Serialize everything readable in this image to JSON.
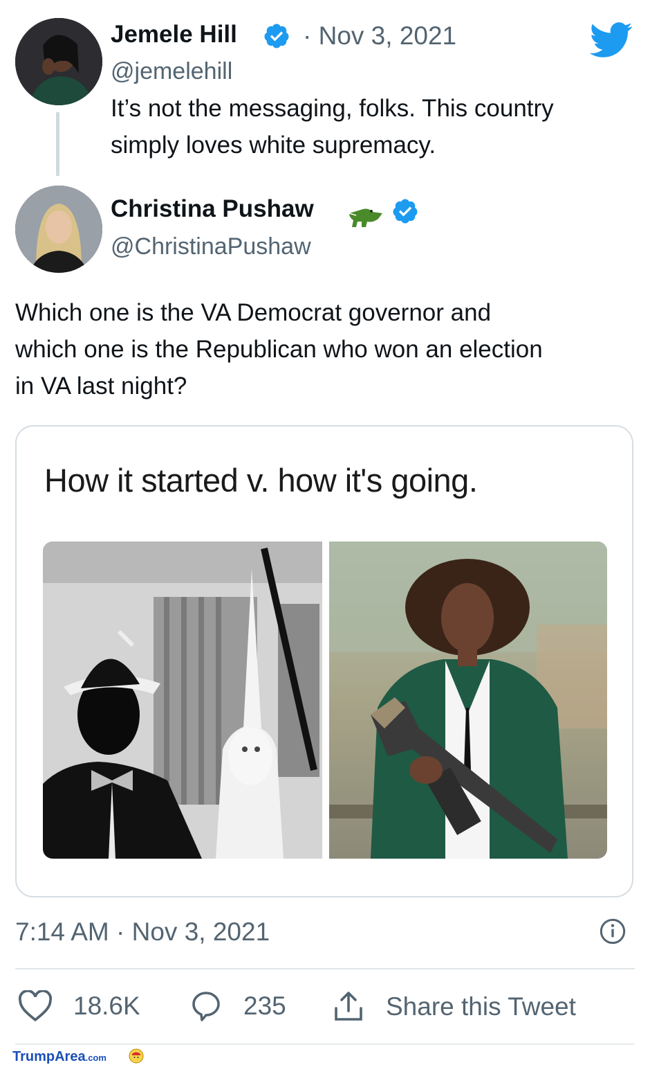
{
  "tweet1": {
    "name": "Jemele Hill",
    "date": "· Nov 3, 2021",
    "handle": "@jemelehill",
    "text_line1": "It’s not the messaging, folks. This country",
    "text_line2": "simply loves white supremacy."
  },
  "tweet2": {
    "name": "Christina Pushaw",
    "handle": "@ChristinaPushaw",
    "text_line1": "Which one is the VA Democrat governor and",
    "text_line2": "which one is the Republican who won an election",
    "text_line3": "in VA last night?"
  },
  "quote": {
    "caption": "How it started v. how it's going."
  },
  "timestamp": "7:14 AM · Nov 3, 2021",
  "actions": {
    "likes": "18.6K",
    "replies": "235",
    "share_label": "Share this Tweet"
  },
  "watermark": {
    "brand": "TrumpArea",
    "suffix": ".com"
  },
  "colors": {
    "twitter_blue": "#1d9bf0",
    "text_primary": "#0f1419",
    "text_secondary": "#536471"
  },
  "icons": [
    "twitter-bird-icon",
    "verified-badge-icon",
    "crocodile-emoji-icon",
    "heart-icon",
    "reply-icon",
    "share-icon",
    "info-icon"
  ]
}
